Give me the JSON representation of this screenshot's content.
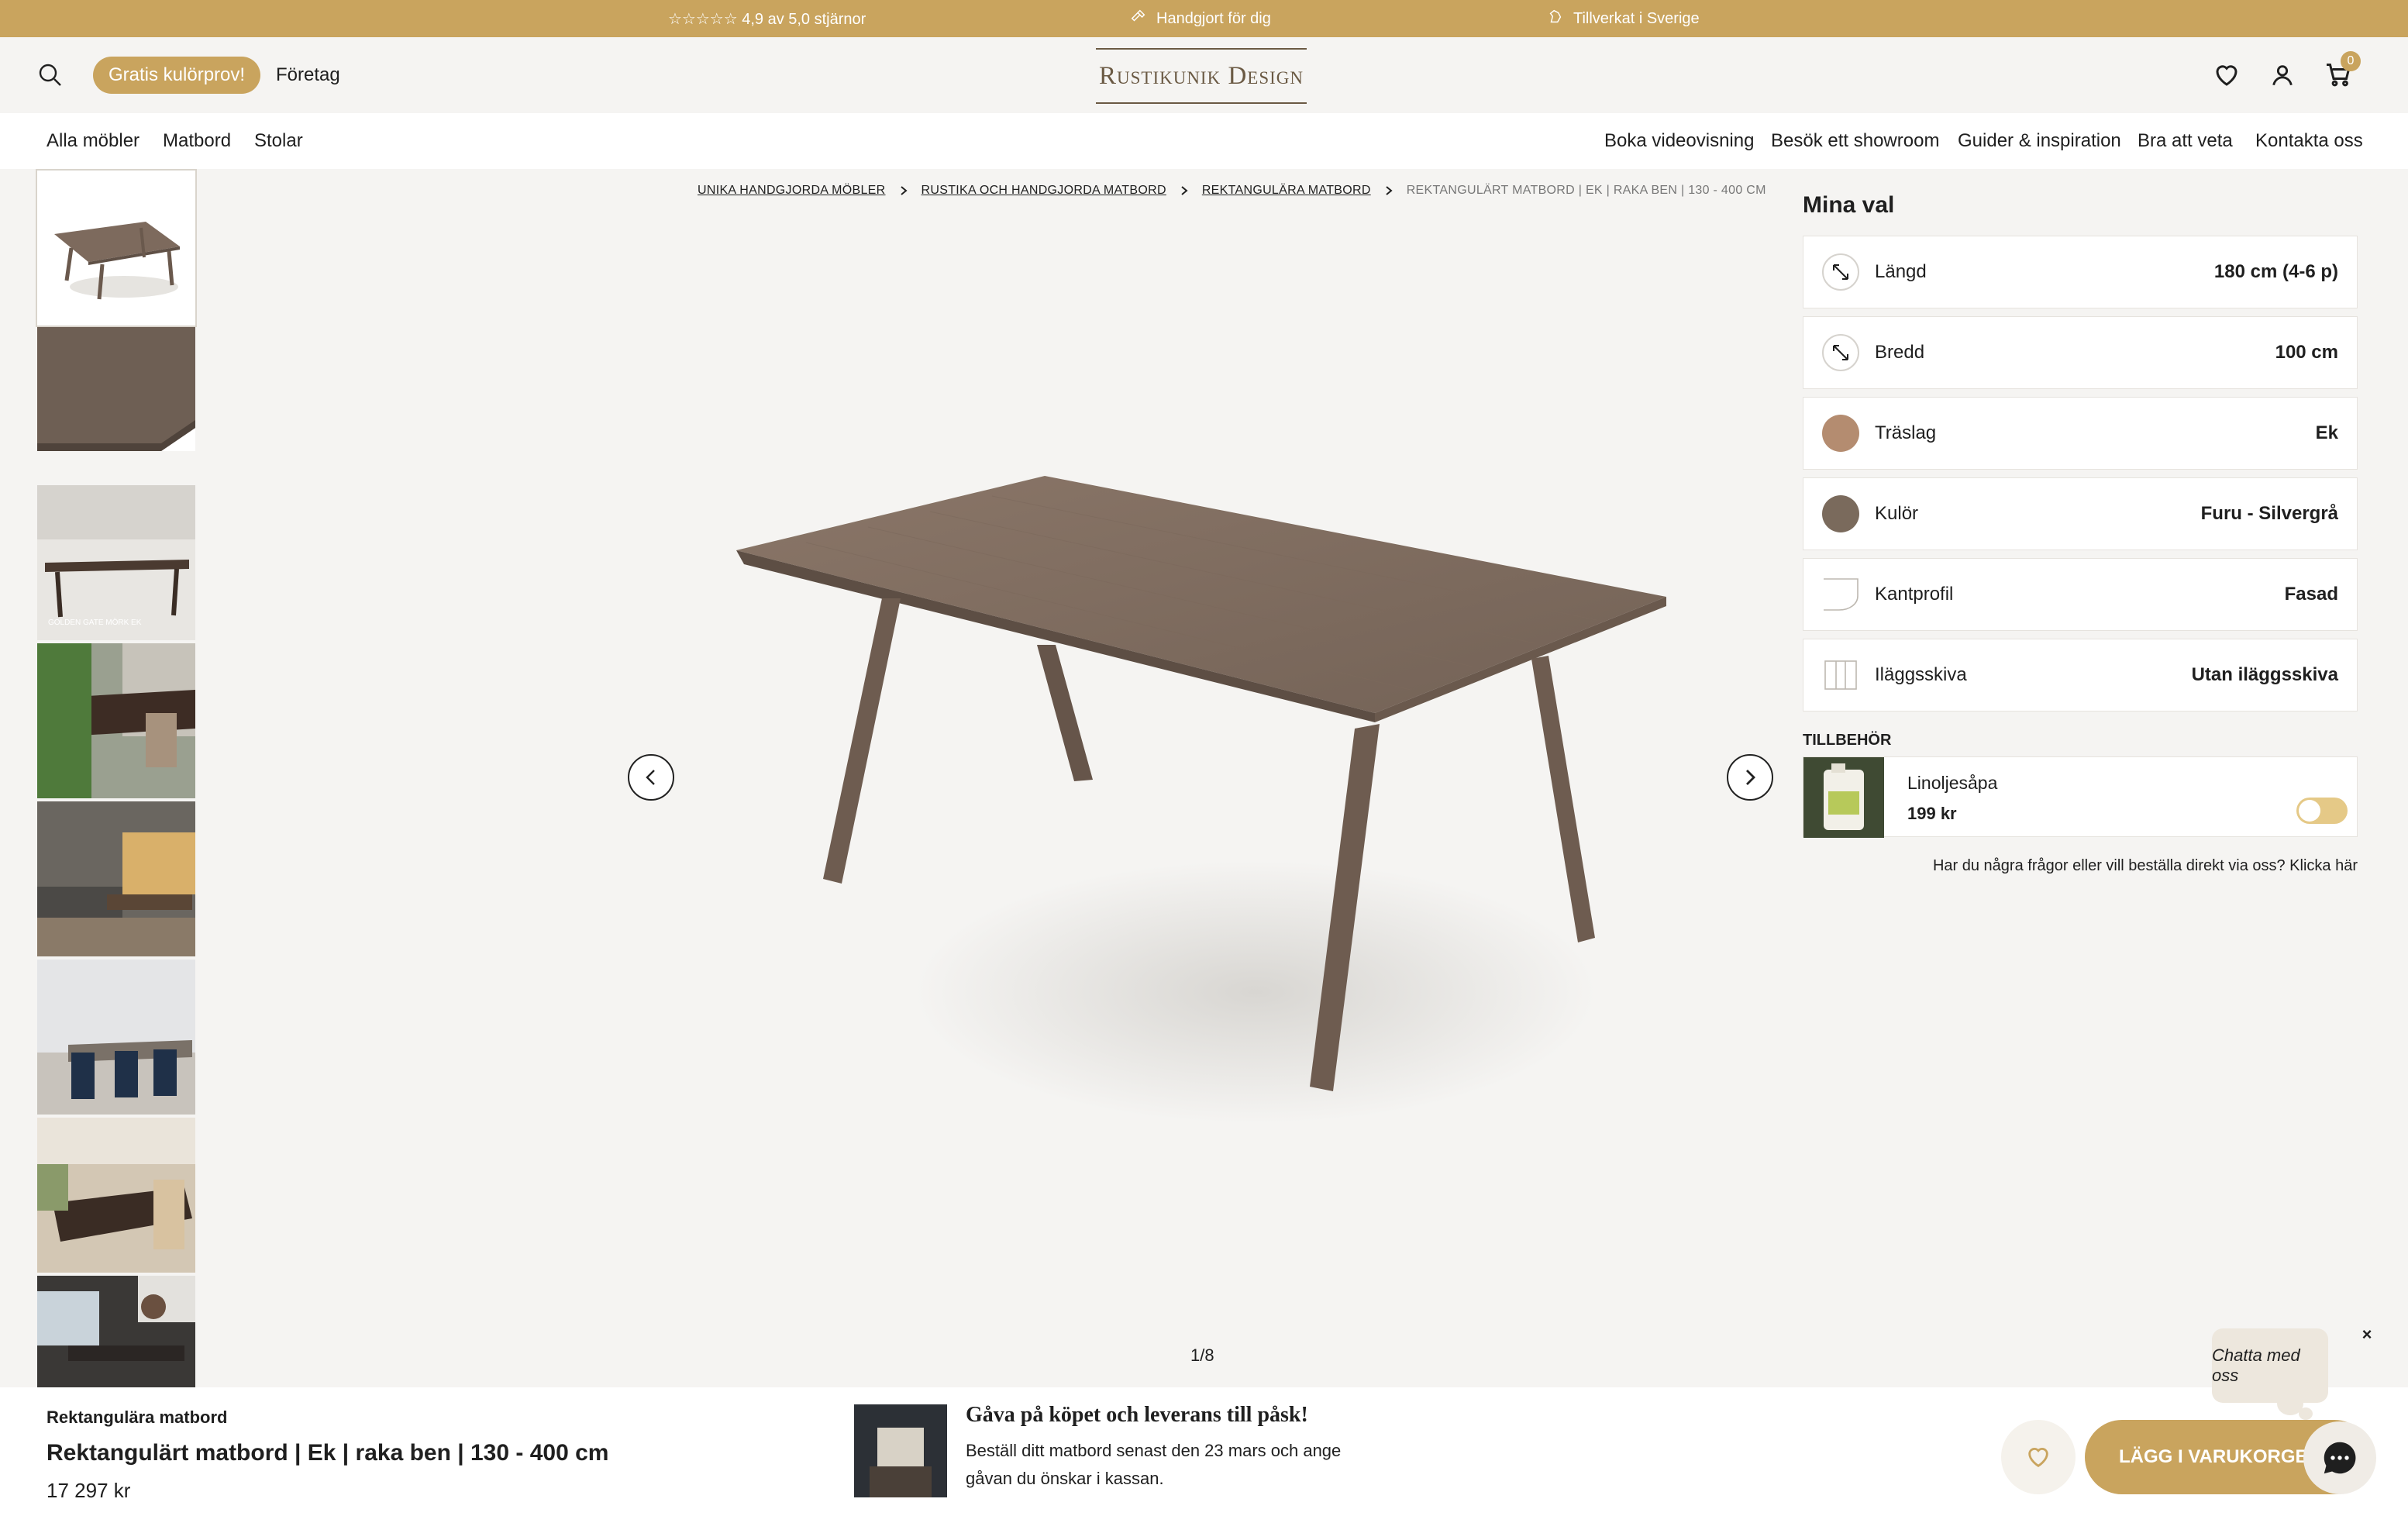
{
  "topbar": {
    "rating": "☆☆☆☆☆ 4,9 av 5,0 stjärnor",
    "handmade": "Handgjort för dig",
    "made_in": "Tillverkat i Sverige"
  },
  "header": {
    "sample_button": "Gratis kulörprov!",
    "company_link": "Företag",
    "logo_text": "Rustikunik Design",
    "cart_count": "0"
  },
  "nav": {
    "left": [
      "Alla möbler",
      "Matbord",
      "Stolar"
    ],
    "right": [
      "Boka videovisning",
      "Besök ett showroom",
      "Guider & inspiration",
      "Bra att veta",
      "Kontakta oss"
    ]
  },
  "breadcrumb": {
    "items": [
      "UNIKA HANDGJORDA MÖBLER",
      "RUSTIKA OCH HANDGJORDA MATBORD",
      "REKTANGULÄRA MATBORD"
    ],
    "current": "REKTANGULÄRT MATBORD | EK | RAKA BEN | 130 - 400 CM"
  },
  "gallery": {
    "counter": "1/8",
    "thumb_caption": "GOLDEN GATE MÖRK EK"
  },
  "options": {
    "title": "Mina val",
    "items": [
      {
        "label": "Längd",
        "value": "180 cm (4-6 p)"
      },
      {
        "label": "Bredd",
        "value": "100 cm"
      },
      {
        "label": "Träslag",
        "value": "Ek"
      },
      {
        "label": "Kulör",
        "value": "Furu - Silvergrå"
      },
      {
        "label": "Kantprofil",
        "value": "Fasad"
      },
      {
        "label": "Iläggsskiva",
        "value": "Utan iläggsskiva"
      }
    ],
    "colors": {
      "traslag": "#b48c70",
      "kulor": "#7a6a5c"
    }
  },
  "accessories": {
    "title": "TILLBEHÖR",
    "name": "Linoljesåpa",
    "price": "199 kr"
  },
  "help_text": "Har du några frågor eller vill beställa direkt via oss? Klicka här",
  "bottom": {
    "category": "Rektangulära matbord",
    "title": "Rektangulärt matbord | Ek | raka ben | 130 - 400 cm",
    "price": "17 297 kr",
    "promo_title": "Gåva på köpet och leverans till påsk!",
    "promo_text": "Beställ ditt matbord senast den 23 mars och ange gåvan du önskar i kassan.",
    "add_to_cart": "LÄGG I VARUKORGEN"
  },
  "chat": {
    "bubble": "Chatta med oss",
    "close": "×"
  },
  "colors": {
    "accent": "#c9a45e",
    "table_wood": "#7d6a5d"
  }
}
